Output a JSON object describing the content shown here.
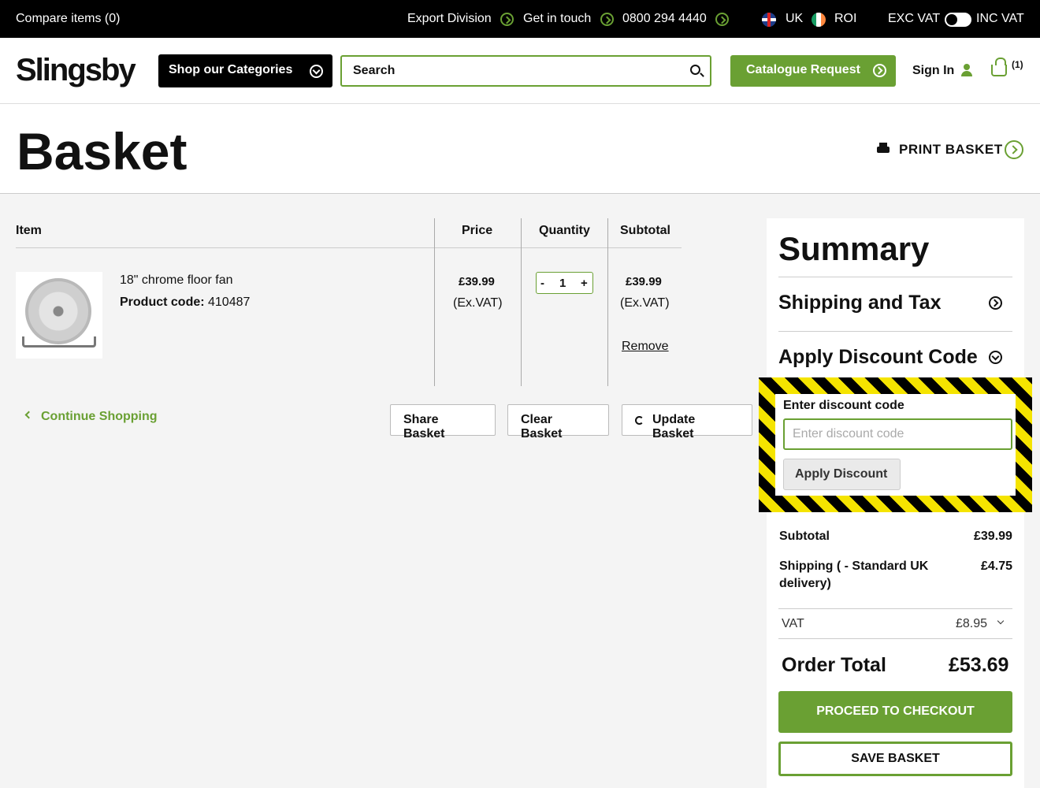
{
  "topbar": {
    "compare": "Compare items (0)",
    "export": "Export Division",
    "contact": "Get in touch",
    "phone": "0800 294 4440",
    "region_uk": "UK",
    "region_roi": "ROI",
    "exc_vat": "EXC VAT",
    "inc_vat": "INC VAT"
  },
  "header": {
    "logo": "Slingsby",
    "categories": "Shop our Categories",
    "search_placeholder": "Search",
    "catalogue": "Catalogue Request",
    "signin": "Sign In",
    "basket_count": "(1)"
  },
  "page": {
    "title": "Basket",
    "print": "PRINT BASKET"
  },
  "table": {
    "headers": {
      "item": "Item",
      "price": "Price",
      "quantity": "Quantity",
      "subtotal": "Subtotal"
    },
    "row": {
      "name": "18\" chrome floor fan",
      "code_label": "Product code:",
      "code": "410487",
      "price": "£39.99",
      "price_note": "(Ex.VAT)",
      "qty_minus": "-",
      "qty": "1",
      "qty_plus": "+",
      "subtotal": "£39.99",
      "subtotal_note": "(Ex.VAT)",
      "remove": "Remove"
    }
  },
  "actions": {
    "continue": "Continue Shopping",
    "share": "Share Basket",
    "clear": "Clear Basket",
    "update": "Update Basket"
  },
  "summary": {
    "title": "Summary",
    "shipping_tax": "Shipping and Tax",
    "discount_heading": "Apply Discount Code",
    "discount_label": "Enter discount code",
    "discount_placeholder": "Enter discount code",
    "apply": "Apply Discount",
    "subtotal_label": "Subtotal",
    "subtotal": "£39.99",
    "shipping_label_1": "Shipping ( - Standard UK",
    "shipping_label_2": "delivery)",
    "shipping": "£4.75",
    "vat_label": "VAT",
    "vat": "£8.95",
    "total_label": "Order Total",
    "total": "£53.69",
    "checkout": "PROCEED TO CHECKOUT",
    "save": "SAVE BASKET"
  },
  "colors": {
    "accent": "#6aa033",
    "topbar": "#000000",
    "hazard_yellow": "#f5e400"
  }
}
